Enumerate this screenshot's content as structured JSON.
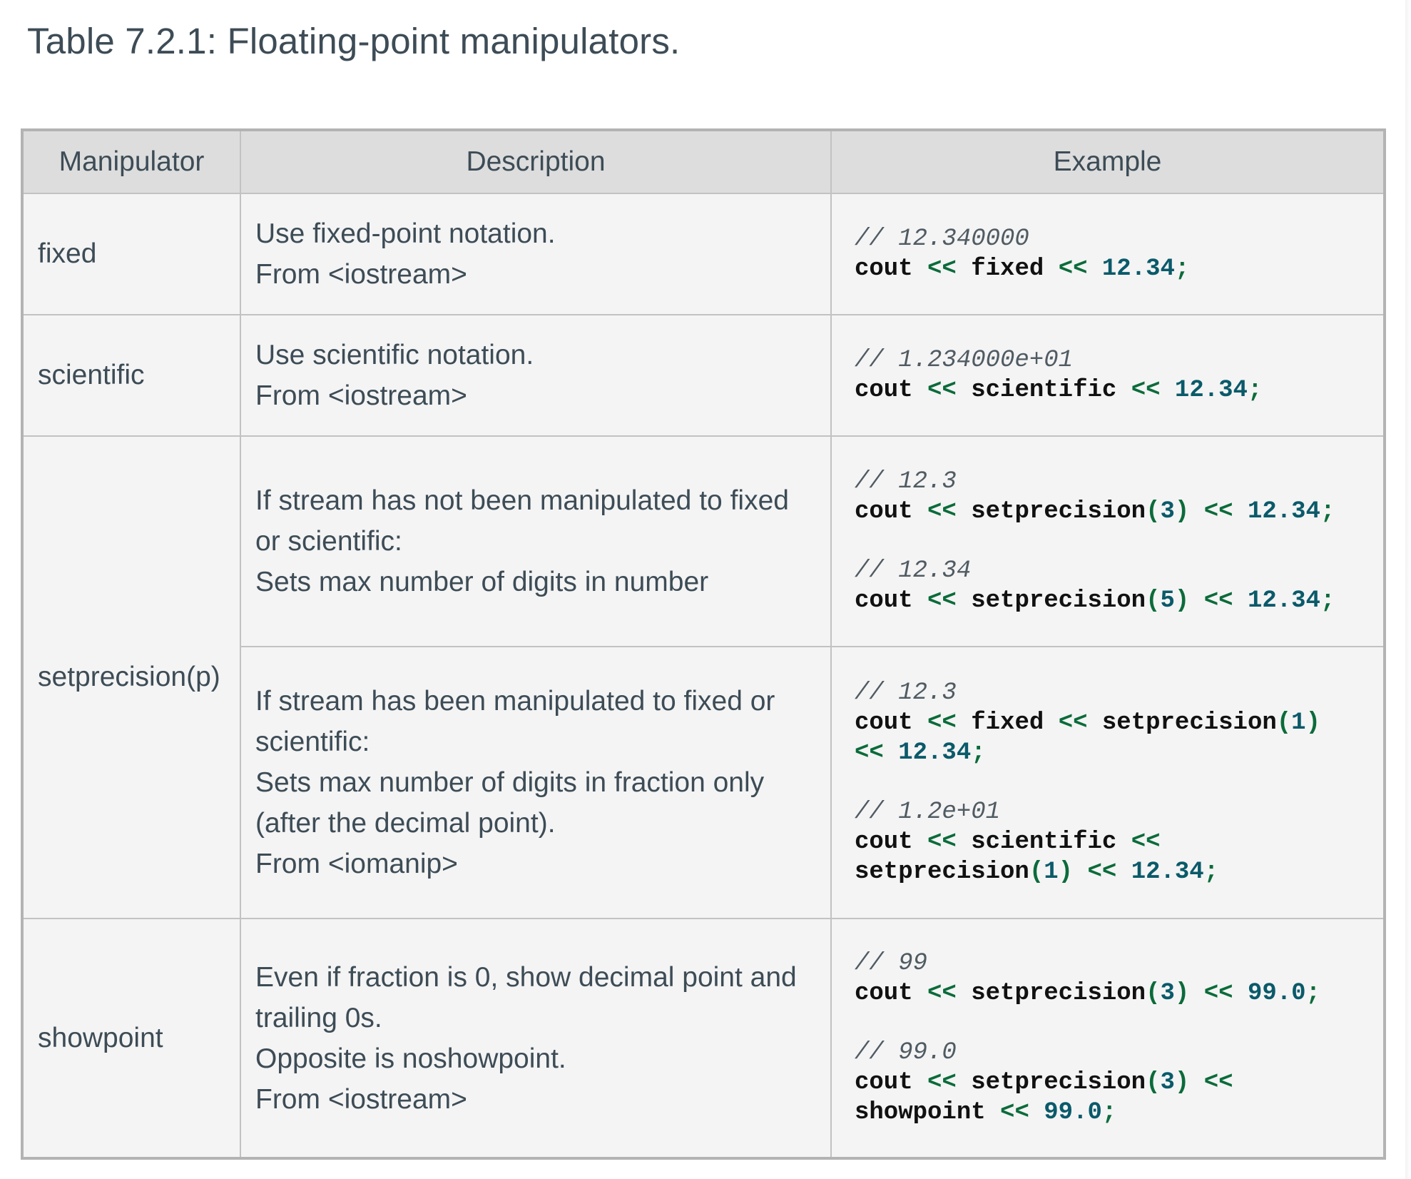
{
  "caption": "Table 7.2.1: Floating-point manipulators.",
  "table": {
    "headers": [
      "Manipulator",
      "Description",
      "Example"
    ],
    "rows": [
      {
        "manipulator": "fixed",
        "description": [
          "Use fixed-point notation.",
          "From <iostream>"
        ],
        "examples": [
          {
            "comment": "// 12.340000",
            "code": [
              [
                [
                  "cout",
                  "id"
                ],
                [
                  " ",
                  "sp"
                ],
                [
                  "<<",
                  "op"
                ],
                [
                  " ",
                  "sp"
                ],
                [
                  "fixed",
                  "id"
                ],
                [
                  " ",
                  "sp"
                ],
                [
                  "<<",
                  "op"
                ],
                [
                  " ",
                  "sp"
                ],
                [
                  "12.34",
                  "num"
                ],
                [
                  ";",
                  "op"
                ]
              ]
            ]
          }
        ]
      },
      {
        "manipulator": "scientific",
        "description": [
          "Use scientific notation.",
          "From <iostream>"
        ],
        "examples": [
          {
            "comment": "// 1.234000e+01",
            "code": [
              [
                [
                  "cout",
                  "id"
                ],
                [
                  " ",
                  "sp"
                ],
                [
                  "<<",
                  "op"
                ],
                [
                  " ",
                  "sp"
                ],
                [
                  "scientific",
                  "id"
                ],
                [
                  " ",
                  "sp"
                ],
                [
                  "<<",
                  "op"
                ],
                [
                  " ",
                  "sp"
                ],
                [
                  "12.34",
                  "num"
                ],
                [
                  ";",
                  "op"
                ]
              ]
            ]
          }
        ]
      },
      {
        "manipulator": "setprecision(p)",
        "description": [
          "If stream has not been manipulated to fixed",
          "or scientific:",
          "Sets max number of digits in number"
        ],
        "examples": [
          {
            "comment": "// 12.3",
            "code": [
              [
                [
                  "cout",
                  "id"
                ],
                [
                  " ",
                  "sp"
                ],
                [
                  "<<",
                  "op"
                ],
                [
                  " ",
                  "sp"
                ],
                [
                  "setprecision",
                  "id"
                ],
                [
                  "(",
                  "op"
                ],
                [
                  "3",
                  "num"
                ],
                [
                  ")",
                  "op"
                ],
                [
                  " ",
                  "sp"
                ],
                [
                  "<<",
                  "op"
                ],
                [
                  " ",
                  "sp"
                ],
                [
                  "12.34",
                  "num"
                ],
                [
                  ";",
                  "op"
                ]
              ]
            ]
          },
          {
            "comment": "// 12.34",
            "code": [
              [
                [
                  "cout",
                  "id"
                ],
                [
                  " ",
                  "sp"
                ],
                [
                  "<<",
                  "op"
                ],
                [
                  " ",
                  "sp"
                ],
                [
                  "setprecision",
                  "id"
                ],
                [
                  "(",
                  "op"
                ],
                [
                  "5",
                  "num"
                ],
                [
                  ")",
                  "op"
                ],
                [
                  " ",
                  "sp"
                ],
                [
                  "<<",
                  "op"
                ],
                [
                  " ",
                  "sp"
                ],
                [
                  "12.34",
                  "num"
                ],
                [
                  ";",
                  "op"
                ]
              ]
            ]
          }
        ]
      },
      {
        "manipulator": "",
        "description": [
          "If stream has been manipulated to fixed or",
          "scientific:",
          "Sets max number of digits in fraction only",
          "(after the decimal point).",
          "From <iomanip>"
        ],
        "examples": [
          {
            "comment": "// 12.3",
            "code": [
              [
                [
                  "cout",
                  "id"
                ],
                [
                  " ",
                  "sp"
                ],
                [
                  "<<",
                  "op"
                ],
                [
                  " ",
                  "sp"
                ],
                [
                  "fixed",
                  "id"
                ],
                [
                  " ",
                  "sp"
                ],
                [
                  "<<",
                  "op"
                ],
                [
                  " ",
                  "sp"
                ],
                [
                  "setprecision",
                  "id"
                ],
                [
                  "(",
                  "op"
                ],
                [
                  "1",
                  "num"
                ],
                [
                  ")",
                  "op"
                ]
              ],
              [
                [
                  "<<",
                  "op"
                ],
                [
                  " ",
                  "sp"
                ],
                [
                  "12.34",
                  "num"
                ],
                [
                  ";",
                  "op"
                ]
              ]
            ]
          },
          {
            "comment": "// 1.2e+01",
            "code": [
              [
                [
                  "cout",
                  "id"
                ],
                [
                  " ",
                  "sp"
                ],
                [
                  "<<",
                  "op"
                ],
                [
                  " ",
                  "sp"
                ],
                [
                  "scientific",
                  "id"
                ],
                [
                  " ",
                  "sp"
                ],
                [
                  "<<",
                  "op"
                ]
              ],
              [
                [
                  "setprecision",
                  "id"
                ],
                [
                  "(",
                  "op"
                ],
                [
                  "1",
                  "num"
                ],
                [
                  ")",
                  "op"
                ],
                [
                  " ",
                  "sp"
                ],
                [
                  "<<",
                  "op"
                ],
                [
                  " ",
                  "sp"
                ],
                [
                  "12.34",
                  "num"
                ],
                [
                  ";",
                  "op"
                ]
              ]
            ]
          }
        ]
      },
      {
        "manipulator": "showpoint",
        "description": [
          "Even if fraction is 0, show decimal point and",
          "trailing 0s.",
          "Opposite is noshowpoint.",
          "From <iostream>"
        ],
        "examples": [
          {
            "comment": "// 99",
            "code": [
              [
                [
                  "cout",
                  "id"
                ],
                [
                  " ",
                  "sp"
                ],
                [
                  "<<",
                  "op"
                ],
                [
                  " ",
                  "sp"
                ],
                [
                  "setprecision",
                  "id"
                ],
                [
                  "(",
                  "op"
                ],
                [
                  "3",
                  "num"
                ],
                [
                  ")",
                  "op"
                ],
                [
                  " ",
                  "sp"
                ],
                [
                  "<<",
                  "op"
                ],
                [
                  " ",
                  "sp"
                ],
                [
                  "99.0",
                  "num"
                ],
                [
                  ";",
                  "op"
                ]
              ]
            ]
          },
          {
            "comment": "// 99.0",
            "code": [
              [
                [
                  "cout",
                  "id"
                ],
                [
                  " ",
                  "sp"
                ],
                [
                  "<<",
                  "op"
                ],
                [
                  " ",
                  "sp"
                ],
                [
                  "setprecision",
                  "id"
                ],
                [
                  "(",
                  "op"
                ],
                [
                  "3",
                  "num"
                ],
                [
                  ")",
                  "op"
                ],
                [
                  " ",
                  "sp"
                ],
                [
                  "<<",
                  "op"
                ]
              ],
              [
                [
                  "showpoint",
                  "id"
                ],
                [
                  " ",
                  "sp"
                ],
                [
                  "<<",
                  "op"
                ],
                [
                  " ",
                  "sp"
                ],
                [
                  "99.0",
                  "num"
                ],
                [
                  ";",
                  "op"
                ]
              ]
            ]
          }
        ]
      }
    ]
  },
  "colors": {
    "header_bg": "#dddddd",
    "cell_bg": "#f4f4f4",
    "border": "#c2c2c2",
    "text": "#3d4c56",
    "code_identifier": "#111111",
    "code_operator": "#0b6b3a",
    "code_number": "#0a5a6a",
    "code_comment": "#505b63"
  }
}
